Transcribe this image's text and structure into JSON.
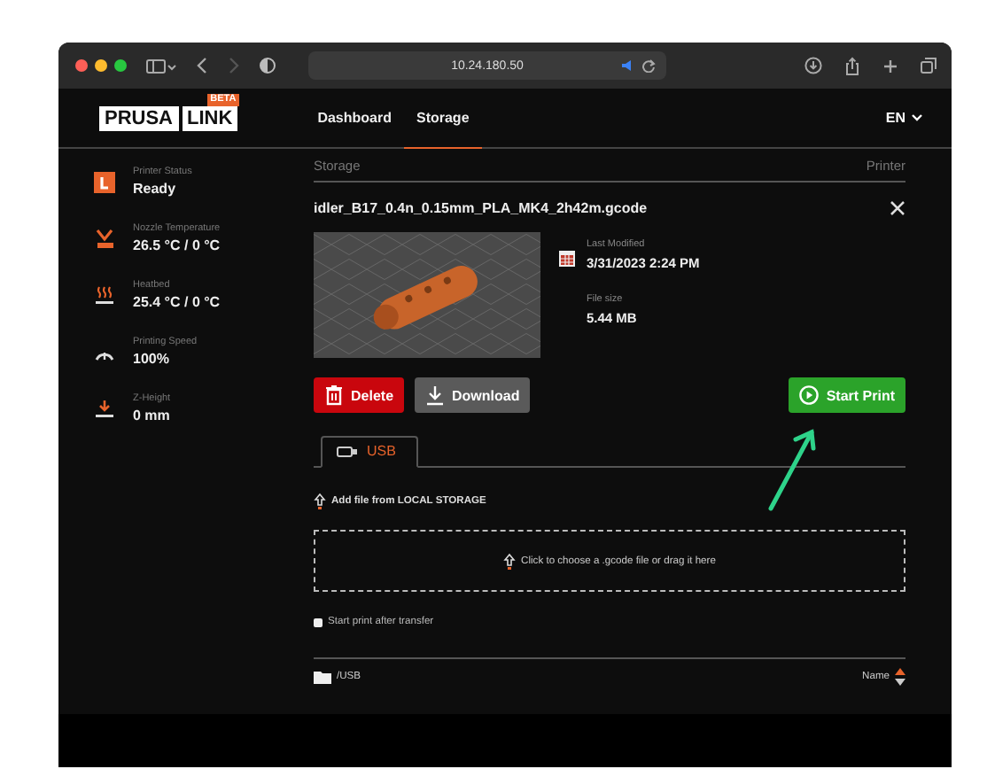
{
  "browser": {
    "url": "10.24.180.50"
  },
  "header": {
    "logo": [
      "PRUSA",
      "LINK"
    ],
    "badge": "BETA",
    "nav": [
      {
        "label": "Dashboard",
        "selected": false
      },
      {
        "label": "Storage",
        "selected": true
      }
    ],
    "language": "EN"
  },
  "sidebar": [
    {
      "kind": "status",
      "label": "Printer Status",
      "value": "Ready"
    },
    {
      "kind": "nozzle",
      "label": "Nozzle Temperature",
      "value": "26.5 °C / 0 °C"
    },
    {
      "kind": "heatbed",
      "label": "Heatbed",
      "value": "25.4 °C / 0 °C"
    },
    {
      "kind": "speed",
      "label": "Printing Speed",
      "value": "100%"
    },
    {
      "kind": "zheight",
      "label": "Z-Height",
      "value": "0 mm"
    }
  ],
  "breadcrumb": {
    "left": "Storage",
    "right": "Printer"
  },
  "file": {
    "name": "idler_B17_0.4n_0.15mm_PLA_MK4_2h42m.gcode",
    "details": [
      {
        "kind": "date",
        "label": "Last Modified",
        "value": "3/31/2023 2:24 PM"
      },
      {
        "kind": "size",
        "label": "File size",
        "value": "5.44 MB"
      }
    ],
    "buttons": [
      {
        "kind": "delete",
        "label": "Delete"
      },
      {
        "kind": "download",
        "label": "Download"
      },
      {
        "kind": "print",
        "label": "Start Print"
      }
    ]
  },
  "tabs": [
    {
      "label": "USB",
      "selected": true
    }
  ],
  "add_file": "Add file from LOCAL STORAGE",
  "dropzone": "Click to choose a .gcode file or drag it here",
  "start_after_transfer": {
    "label": "Start print after transfer",
    "checked": false
  },
  "listing": {
    "path": "/USB",
    "sort": "Name"
  }
}
